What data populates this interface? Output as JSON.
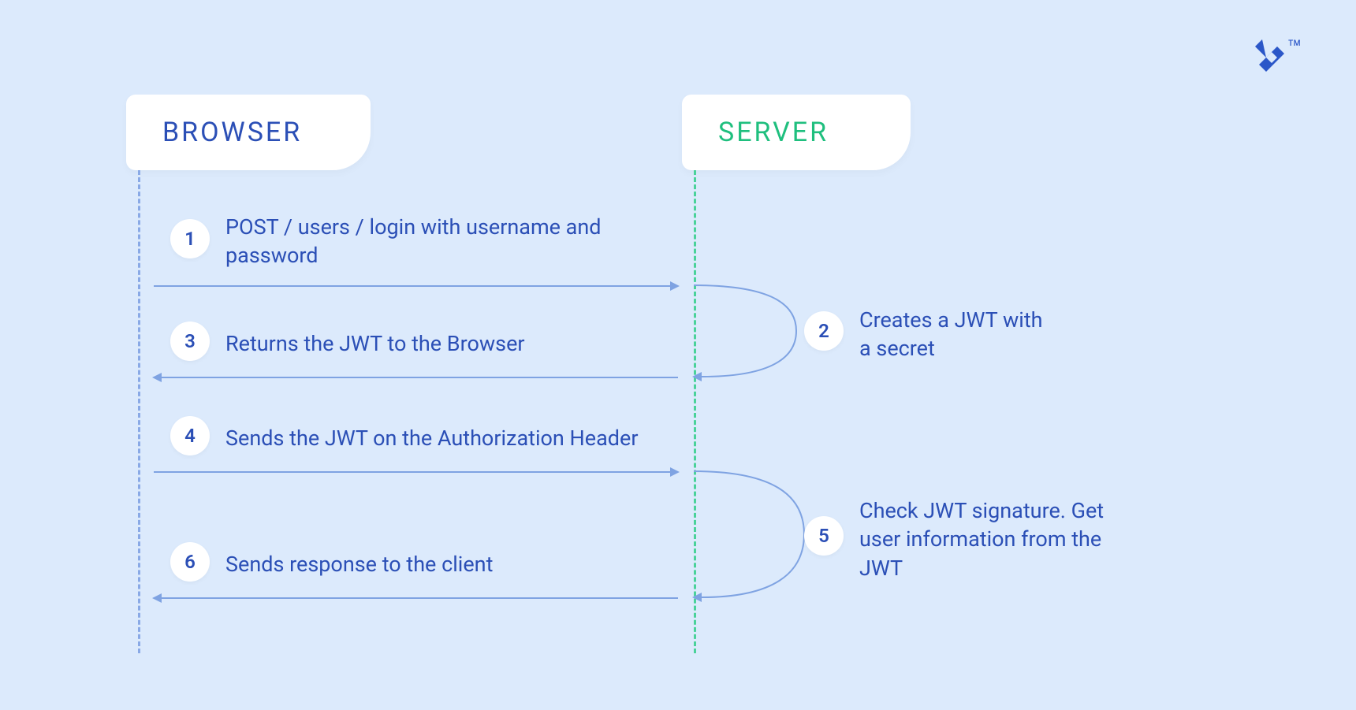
{
  "colors": {
    "background": "#dceafc",
    "browser_accent": "#2b4fb6",
    "server_accent": "#1fbf7e",
    "arrow": "#7fa3e2",
    "badge_bg": "#ffffff"
  },
  "logo": {
    "name": "toptal-logo",
    "trademark": "TM"
  },
  "headers": {
    "browser": "BROWSER",
    "server": "SERVER"
  },
  "steps": {
    "s1": {
      "num": "1",
      "text": "POST / users / login with username and password"
    },
    "s2": {
      "num": "2",
      "text": "Creates a JWT with a secret"
    },
    "s3": {
      "num": "3",
      "text": "Returns the JWT to the Browser"
    },
    "s4": {
      "num": "4",
      "text": "Sends the JWT on the Authorization Header"
    },
    "s5": {
      "num": "5",
      "text": "Check JWT signature. Get user information from the JWT"
    },
    "s6": {
      "num": "6",
      "text": "Sends response to the client"
    }
  },
  "flow": [
    {
      "step": "s1",
      "from": "browser",
      "to": "server",
      "direction": "right"
    },
    {
      "step": "s2",
      "at": "server"
    },
    {
      "step": "s3",
      "from": "server",
      "to": "browser",
      "direction": "left"
    },
    {
      "step": "s4",
      "from": "browser",
      "to": "server",
      "direction": "right"
    },
    {
      "step": "s5",
      "at": "server"
    },
    {
      "step": "s6",
      "from": "server",
      "to": "browser",
      "direction": "left"
    }
  ]
}
